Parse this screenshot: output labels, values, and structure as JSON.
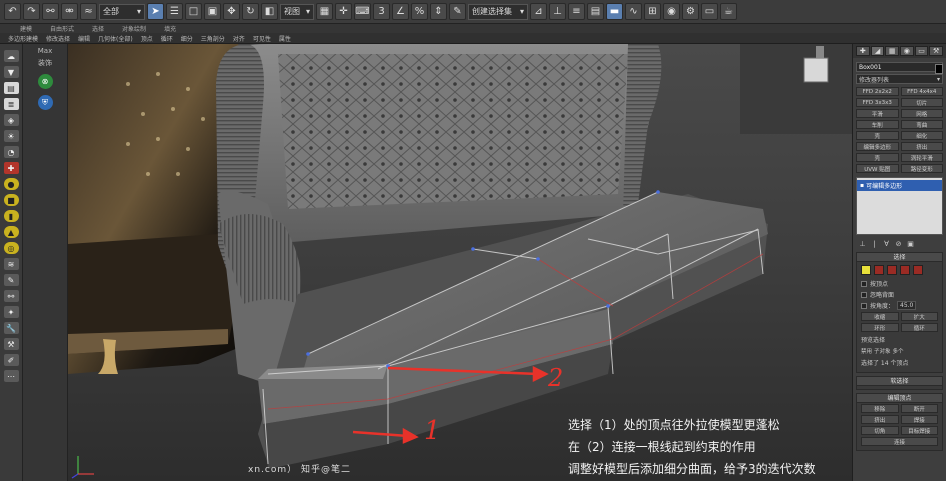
{
  "toolbar": {
    "dropdown_all": "全部",
    "dropdown_view": "视图",
    "dropdown_selection": "创建选择集"
  },
  "ribbon": {
    "tabs": [
      "建模",
      "自由形式",
      "选择",
      "对象绘制",
      "填充"
    ],
    "subtabs": [
      "多边形建模",
      "修改选择",
      "编辑",
      "几何体(全部)",
      "顶点",
      "循环",
      "细分",
      "三角剖分",
      "对齐",
      "可见性",
      "属性"
    ]
  },
  "left_panel": {
    "tag": "Max",
    "sub_tag": "装饰"
  },
  "viewport": {
    "annotation_lines": [
      "选择（1）处的顶点往外拉使模型更蓬松",
      "在（2）连接一根线起到约束的作用",
      "调整好模型后添加细分曲面，给予3的迭代次数"
    ],
    "marker_1": "1",
    "marker_2": "2",
    "watermark": "xn.com）  知乎@笔二"
  },
  "command_panel": {
    "object_name": "Box001",
    "modifier_list": "修改器列表",
    "modifier_buttons": [
      "FFD 2x2x2",
      "FFD 4x4x4",
      "FFD 3x3x3",
      "切片",
      "平滑",
      "网格",
      "车削",
      "弯曲",
      "壳",
      "细化",
      "编辑多边形",
      "挤出",
      "壳",
      "涡轮平滑",
      "UVW 贴图",
      "路径变形"
    ],
    "stack_item": "可编辑多边形",
    "selection_header": "选择",
    "by_vertex": "按顶点",
    "ignore_backfacing": "忽略背面",
    "by_angle": "按角度：",
    "by_angle_value": "45.0",
    "shrink": "收缩",
    "grow": "扩大",
    "ring": "环形",
    "loop": "循环",
    "preview_label": "预览选择",
    "preview_off": "禁用",
    "preview_subobj": "子对象",
    "preview_multi": "多个",
    "selected_count": "选择了 14 个顶点",
    "soft_selection": "软选择",
    "edit_vertices": "编辑顶点",
    "remove": "移除",
    "break": "断开",
    "extrude": "挤出",
    "weld": "焊接",
    "chamfer": "切角",
    "target_weld": "目标焊接",
    "connect": "连接"
  },
  "colors": {
    "accent_blue": "#2f5fb0",
    "annotation_red": "#e8322a",
    "selection_yellow": "#e8e03a"
  }
}
